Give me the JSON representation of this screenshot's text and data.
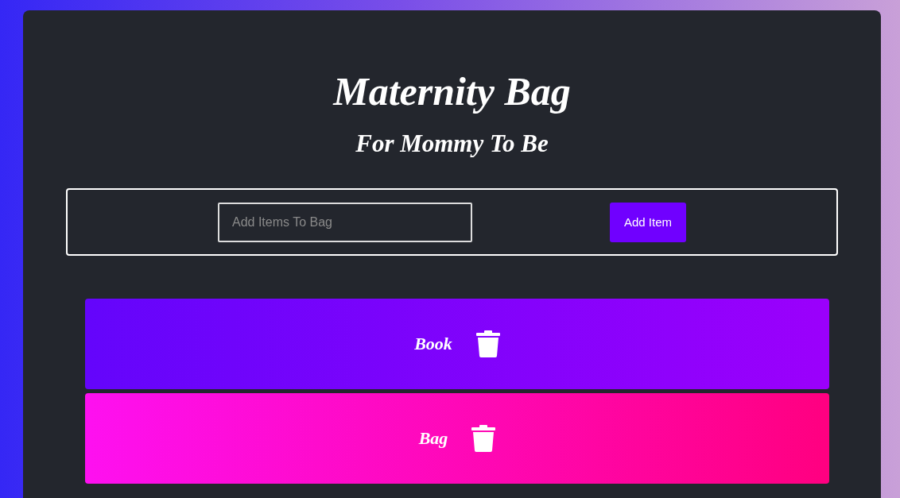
{
  "title": "Maternity Bag",
  "subtitle": "For Mommy To Be",
  "form": {
    "placeholder": "Add Items To Bag",
    "button": "Add Item"
  },
  "items": [
    {
      "label": "Book"
    },
    {
      "label": "Bag"
    }
  ]
}
